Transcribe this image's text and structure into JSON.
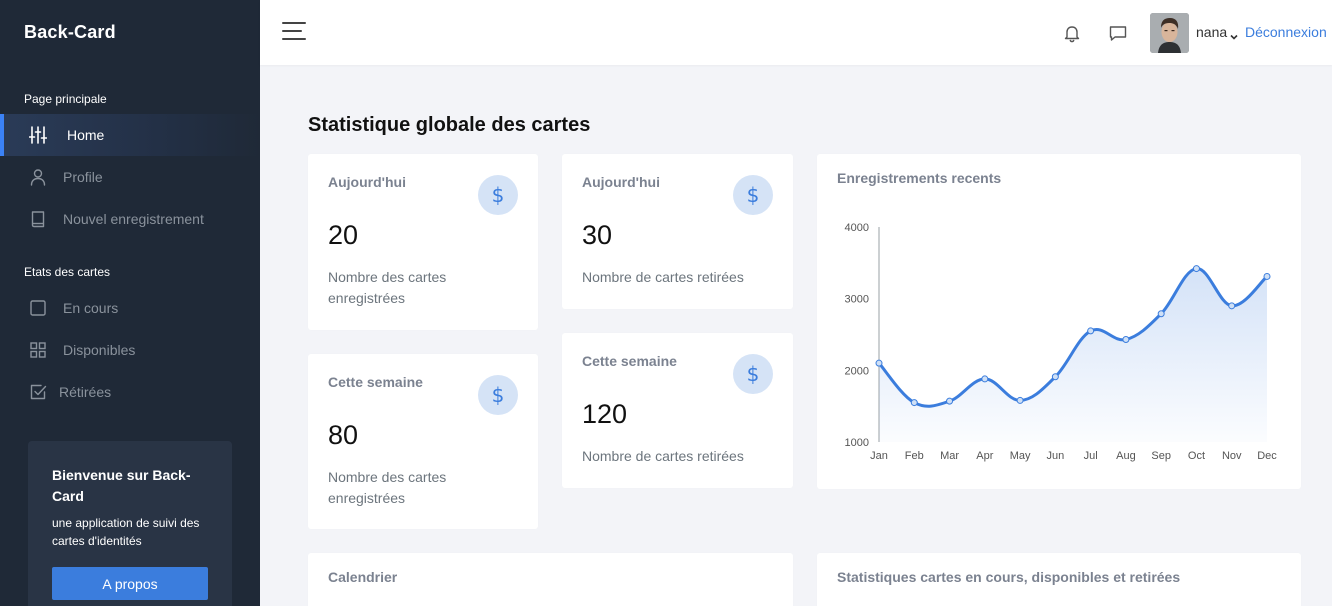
{
  "brand": "Back-Card",
  "sidebar": {
    "sections": [
      {
        "label": "Page principale"
      },
      {
        "label": "Etats des cartes"
      }
    ],
    "items": [
      {
        "label": "Home",
        "icon": "sliders-icon",
        "active": true
      },
      {
        "label": "Profile",
        "icon": "user-icon"
      },
      {
        "label": "Nouvel enregistrement",
        "icon": "book-icon"
      },
      {
        "label": "En cours",
        "icon": "square-icon"
      },
      {
        "label": "Disponibles",
        "icon": "grid-icon"
      },
      {
        "label": "Rétirées",
        "icon": "check-square-icon"
      }
    ],
    "welcome": {
      "title": "Bienvenue sur Back-Card",
      "text": "une application de suivi des cartes d'identités",
      "button": "A propos"
    }
  },
  "topbar": {
    "user_name": "nana",
    "logout": "Déconnexion"
  },
  "main": {
    "title": "Statistique globale des cartes",
    "stats": [
      {
        "title": "Aujourd'hui",
        "value": "20",
        "desc": "Nombre des cartes enregistrées"
      },
      {
        "title": "Cette semaine",
        "value": "80",
        "desc": "Nombre des cartes enregistrées"
      },
      {
        "title": "Aujourd'hui",
        "value": "30",
        "desc": "Nombre de cartes retirées"
      },
      {
        "title": "Cette semaine",
        "value": "120",
        "desc": "Nombre de cartes retirées"
      }
    ],
    "stat_icon_symbol": "$",
    "chart_title": "Enregistrements recents",
    "bottom_left_title": "Calendrier",
    "bottom_right_title": "Statistiques cartes en cours, disponibles et retirées"
  },
  "colors": {
    "accent": "#3b7ddd",
    "sidebar_bg": "#1f2937",
    "line": "#3b7ddd"
  },
  "chart_data": {
    "type": "area",
    "categories": [
      "Jan",
      "Feb",
      "Mar",
      "Apr",
      "May",
      "Jun",
      "Jul",
      "Aug",
      "Sep",
      "Oct",
      "Nov",
      "Dec"
    ],
    "values": [
      2100,
      1550,
      1570,
      1880,
      1580,
      1910,
      2550,
      2430,
      2790,
      3420,
      2900,
      3310
    ],
    "yticks": [
      1000,
      2000,
      3000,
      4000
    ],
    "ylim": [
      1000,
      4000
    ],
    "grid": false,
    "legend": "none"
  }
}
